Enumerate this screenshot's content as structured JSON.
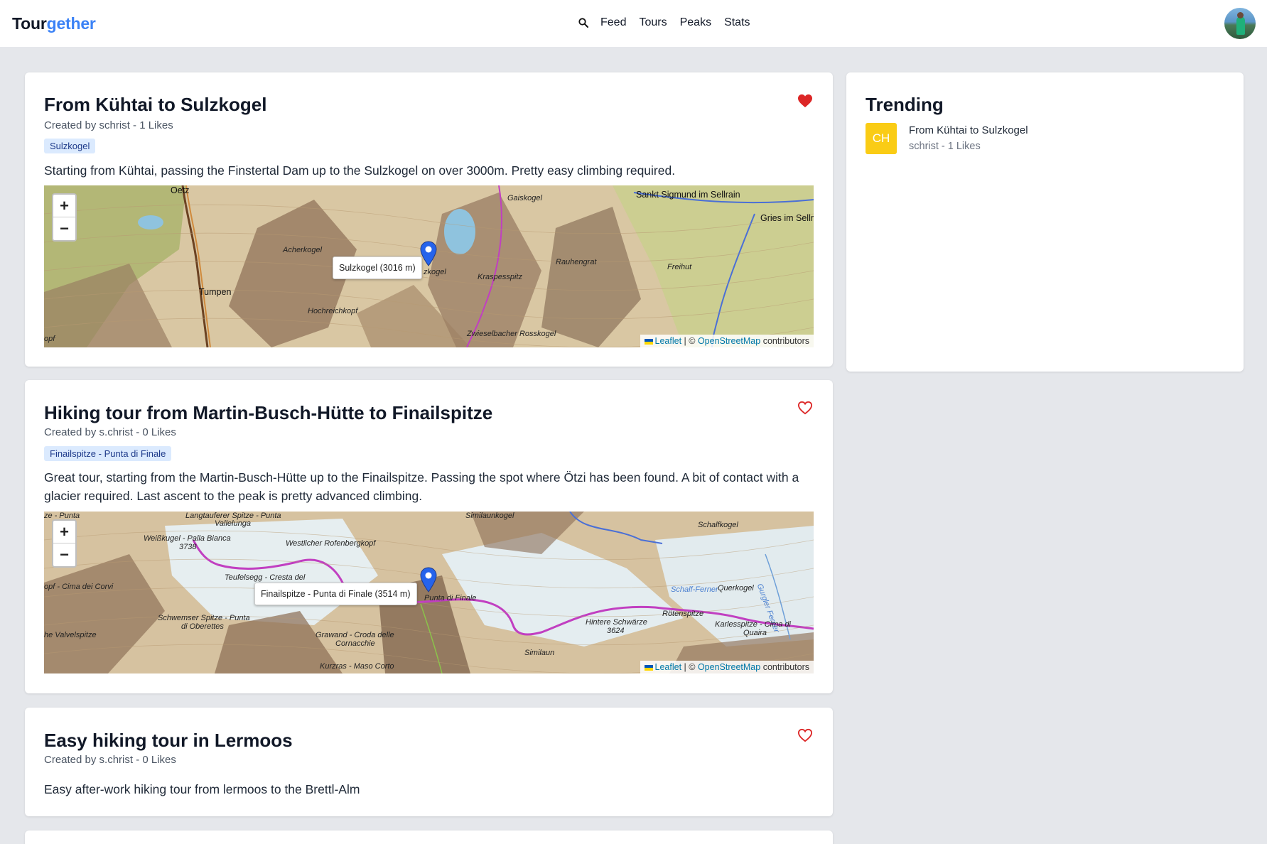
{
  "app": {
    "logo_part1": "Tour",
    "logo_part2": "gether",
    "nav": [
      "Feed",
      "Tours",
      "Peaks",
      "Stats"
    ]
  },
  "tours": [
    {
      "title": "From Kühtai to Sulzkogel",
      "meta": "Created by schrist - 1 Likes",
      "tag": "Sulzkogel",
      "description": "Starting from Kühtai, passing the Finstertal Dam up to the Sulzkogel on over 3000m. Pretty easy climbing required.",
      "liked": true,
      "map": {
        "tooltip": "Sulzkogel (3016 m)",
        "places": [
          "Oetz",
          "Sankt Sigmund im Sellrain",
          "Gries im Sellr",
          "Gaiskogel",
          "Acherkogel",
          "zkogel",
          "Kraspesspitz",
          "Rauhengrat",
          "Freihut",
          "Tumpen",
          "Hochreichkopf",
          "Zwieselbacher Rosskogel",
          "opf"
        ]
      }
    },
    {
      "title": "Hiking tour from Martin-Busch-Hütte to Finailspitze",
      "meta": "Created by s.christ - 0 Likes",
      "tag": "Finailspitze - Punta di Finale",
      "description": "Great tour, starting from the Martin-Busch-Hütte up to the Finailspitze. Passing the spot where Ötzi has been found. A bit of contact with a glacier required. Last ascent to the peak is pretty advanced climbing.",
      "liked": false,
      "map": {
        "tooltip": "Finailspitze - Punta di Finale (3514 m)",
        "places": [
          "ze - Punta",
          "Langtauferer Spitze - Punta",
          "Vallelunga",
          "Similaunkogel",
          "Schalfkogel",
          "Weißkugel - Palla Bianca",
          "3738",
          "Westlicher Rofenbergkopf",
          "Teufelsegg - Cresta del",
          "opf - Cima dei Corvi",
          "Punta di Finale",
          "Schalf-Ferner",
          "Querkogel",
          "Gurgler Ferner",
          "Hintere Schwärze",
          "3624",
          "Rötenspitze",
          "Karlesspitze - Cima di",
          "Quaira",
          "Schwemser Spitze - Punta",
          "di Oberettes",
          "Grawand - Croda delle",
          "Cornacchie",
          "he Valvelspitze",
          "Similaun",
          "Kurzras - Maso Corto"
        ]
      }
    },
    {
      "title": "Easy hiking tour in Lermoos",
      "meta": "Created by s.christ - 0 Likes",
      "description": "Easy after-work hiking tour from lermoos to the Brettl-Alm",
      "liked": false
    }
  ],
  "map_attribution": {
    "leaflet": "Leaflet",
    "sep": "| ©",
    "osm": "OpenStreetMap",
    "suffix": "contributors"
  },
  "trending": {
    "title": "Trending",
    "items": [
      {
        "badge": "CH",
        "name": "From Kühtai to Sulzkogel",
        "meta": "schrist - 1 Likes"
      }
    ]
  },
  "colors": {
    "accent": "#3b82f6",
    "heart": "#dc2626",
    "badge": "#facc15",
    "tag_bg": "#dbeafe",
    "route": "#c13fc1"
  }
}
